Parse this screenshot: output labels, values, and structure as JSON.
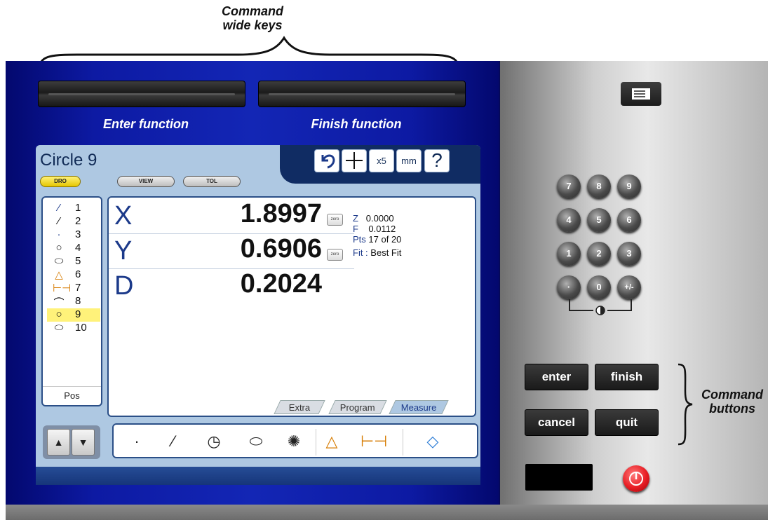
{
  "annotations": {
    "top_line1": "Command",
    "top_line2": "wide keys",
    "right_line1": "Command",
    "right_line2": "buttons"
  },
  "softkey_labels": {
    "left": "Enter function",
    "right": "Finish function"
  },
  "screen": {
    "title": "Circle 9",
    "mode_pills": [
      "DRO",
      "VIEW",
      "TOL"
    ],
    "active_pill": "DRO",
    "toolbar": {
      "undo_icon": "undo-icon",
      "crosshair_icon": "crosshair-icon",
      "magnification": "x5",
      "units": "mm",
      "help": "?"
    },
    "features": [
      {
        "num": "1",
        "icon": "line-short-icon"
      },
      {
        "num": "2",
        "icon": "line-icon"
      },
      {
        "num": "3",
        "icon": "point-icon"
      },
      {
        "num": "4",
        "icon": "circle-icon"
      },
      {
        "num": "5",
        "icon": "slot-icon"
      },
      {
        "num": "6",
        "icon": "angle-icon"
      },
      {
        "num": "7",
        "icon": "distance-icon"
      },
      {
        "num": "8",
        "icon": "arc-icon"
      },
      {
        "num": "9",
        "icon": "circle-icon",
        "selected": true
      },
      {
        "num": "10",
        "icon": "slot-icon"
      }
    ],
    "pos_label": "Pos",
    "readouts": [
      {
        "axis": "X",
        "value": "1.8997",
        "zero_label": "zero"
      },
      {
        "axis": "Y",
        "value": "0.6906",
        "zero_label": "zero"
      },
      {
        "axis": "D",
        "value": "0.2024"
      }
    ],
    "info": {
      "z_label": "Z",
      "z_value": "0.0000",
      "f_label": "F",
      "f_value": "0.0112",
      "pts_label": "Pts",
      "pts_value": "17 of 20",
      "fit_label": "Fit :",
      "fit_value": "Best Fit"
    },
    "tabs": [
      "Extra",
      "Program",
      "Measure"
    ],
    "active_tab": "Measure",
    "measure_tools": [
      "point-tool-icon",
      "line-tool-icon",
      "circle-tool-icon",
      "slot-tool-icon",
      "magic-wand-icon",
      "angle-tool-icon",
      "distance-tool-icon",
      "rectangle-tool-icon"
    ]
  },
  "keypad": {
    "keys": [
      "7",
      "8",
      "9",
      "4",
      "5",
      "6",
      "1",
      "2",
      "3",
      "·",
      "0",
      "+/-"
    ],
    "contrast_icon": "contrast-icon"
  },
  "command_buttons": {
    "enter": "enter",
    "finish": "finish",
    "cancel": "cancel",
    "quit": "quit"
  },
  "colors": {
    "blue_panel": "#1326b5",
    "screen_bg": "#aec8e2",
    "highlight": "#fff27a",
    "power": "#e81d24"
  }
}
